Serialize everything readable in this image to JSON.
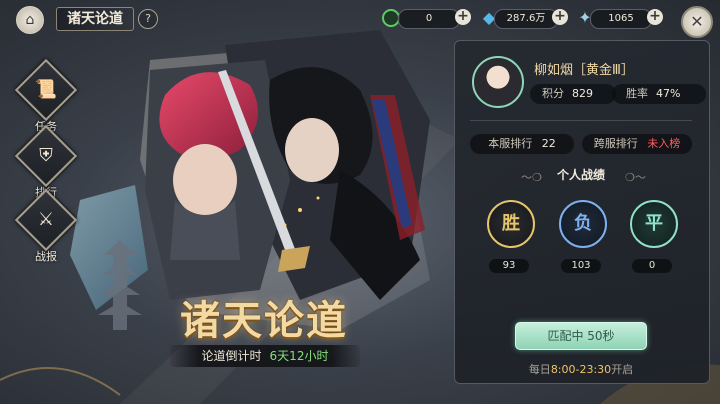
{
  "header": {
    "title": "诸天论道",
    "help": "?"
  },
  "resources": [
    {
      "icon": "jade-ring-icon",
      "value": "0",
      "color": "#5ecb6a"
    },
    {
      "icon": "blue-crystal-icon",
      "value": "287.6万",
      "color": "#54b8e8"
    },
    {
      "icon": "rainbow-feather-icon",
      "value": "1065",
      "color": "#9fd0e8"
    }
  ],
  "menu": [
    {
      "label": "任务",
      "icon": "scroll-icon",
      "glyph": "📜"
    },
    {
      "label": "排行",
      "icon": "banner-icon",
      "glyph": "⛨"
    },
    {
      "label": "战报",
      "icon": "crossed-swords-icon",
      "glyph": "⚔"
    }
  ],
  "event": {
    "title": "诸天论道",
    "countdown_label": "论道倒计时",
    "countdown_value": "6天12小时"
  },
  "player": {
    "name": "柳如烟［黄金Ⅲ］",
    "score_label": "积分",
    "score": "829",
    "winrate_label": "胜率",
    "winrate": "47%"
  },
  "ranking": {
    "server_label": "本服排行",
    "server_value": "22",
    "cross_label": "跨服排行",
    "cross_value": "未入榜"
  },
  "record": {
    "title": "个人战绩",
    "items": [
      {
        "glyph": "胜",
        "value": "93",
        "color": "#e6c46a"
      },
      {
        "glyph": "负",
        "value": "103",
        "color": "#7fb0ee"
      },
      {
        "glyph": "平",
        "value": "0",
        "color": "#8fe0cc"
      }
    ]
  },
  "match": {
    "button": "匹配中 50秒",
    "hours_prefix": "每日",
    "hours": "8:00-23:30",
    "hours_suffix": "开启"
  }
}
